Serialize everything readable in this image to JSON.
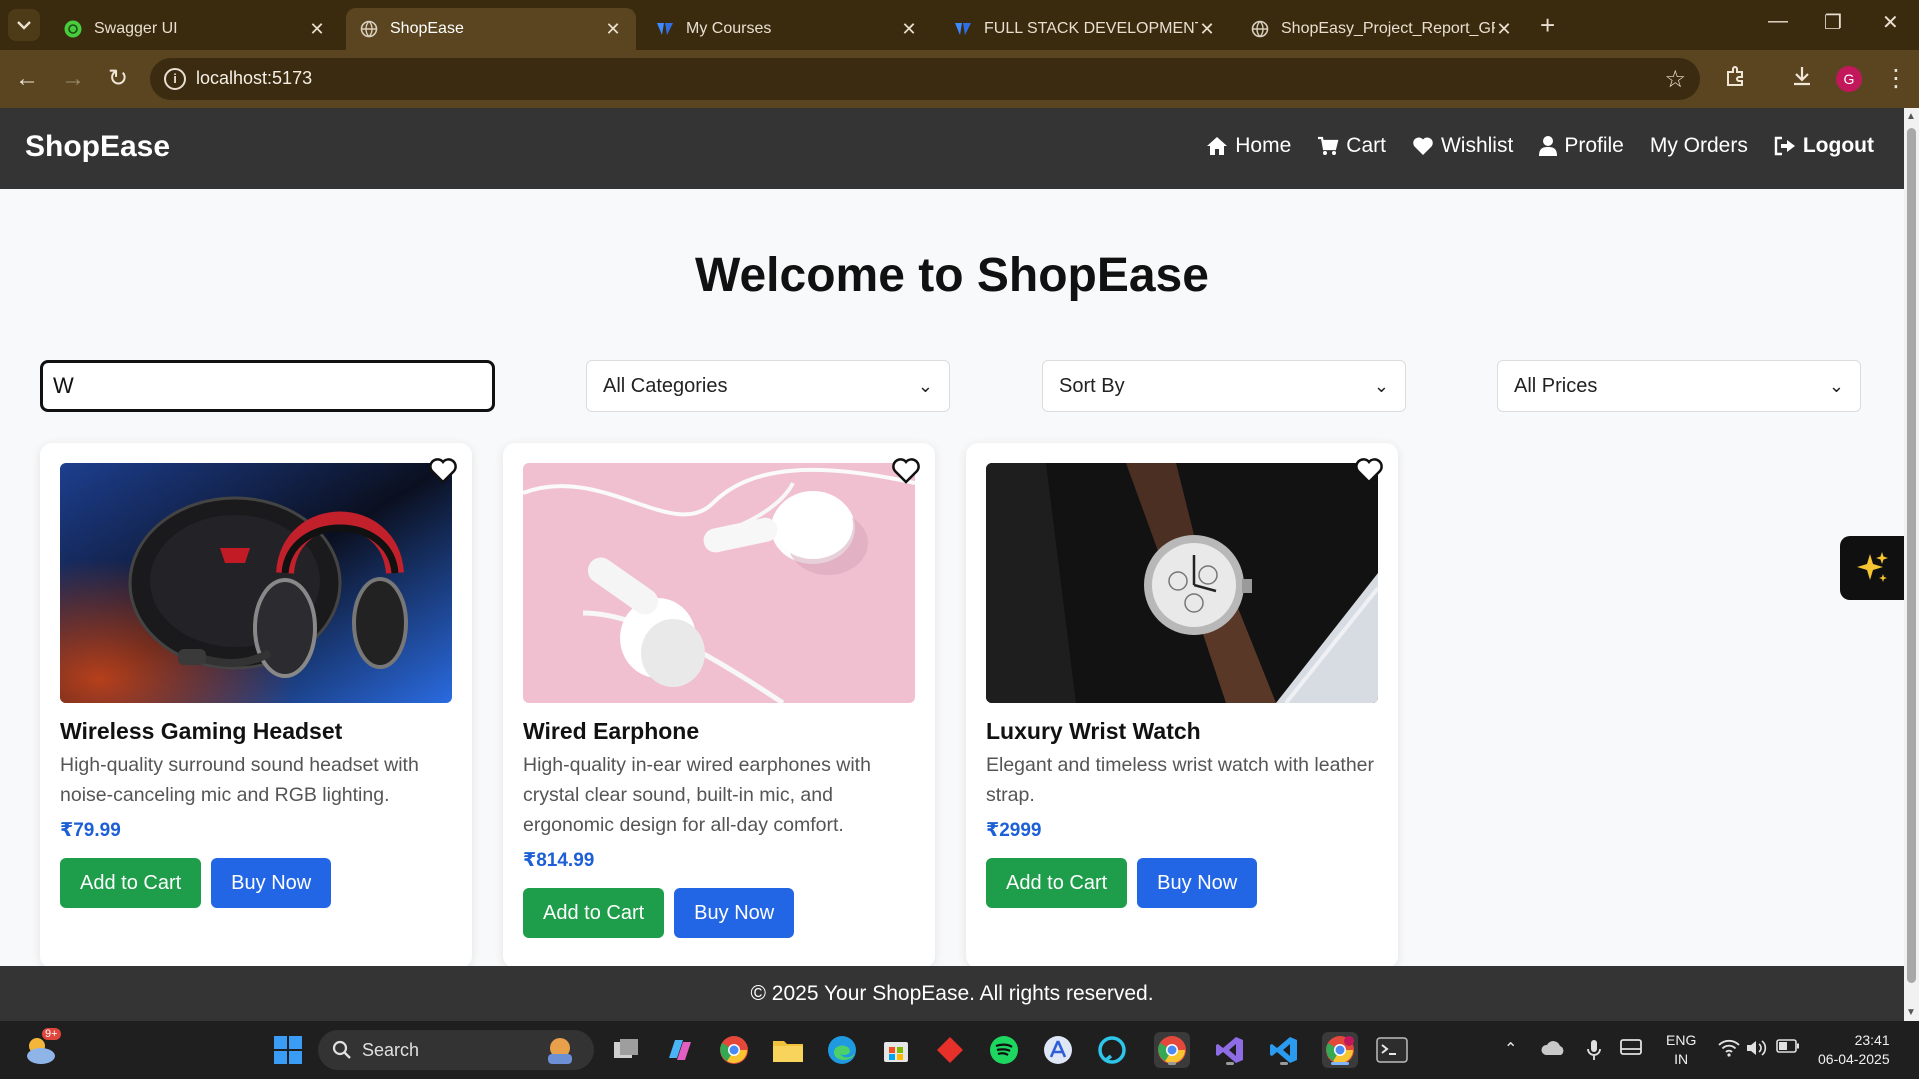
{
  "browser": {
    "tabs": [
      {
        "title": "Swagger UI",
        "active": false
      },
      {
        "title": "ShopEase",
        "active": true
      },
      {
        "title": "My Courses",
        "active": false
      },
      {
        "title": "FULL STACK DEVELOPMENT - C",
        "active": false
      },
      {
        "title": "ShopEasy_Project_Report_GRAC",
        "active": false
      }
    ],
    "url": "localhost:5173",
    "profile_initial": "G"
  },
  "site": {
    "brand": "ShopEase",
    "nav": {
      "home": "Home",
      "cart": "Cart",
      "wishlist": "Wishlist",
      "profile": "Profile",
      "orders": "My Orders",
      "logout": "Logout"
    },
    "hero_title": "Welcome to ShopEase",
    "filters": {
      "search_value": "W",
      "category": "All Categories",
      "sort": "Sort By",
      "price": "All Prices"
    },
    "products": [
      {
        "name": "Wireless Gaming Headset",
        "description": "High-quality surround sound headset with noise-canceling mic and RGB lighting.",
        "price": "₹79.99",
        "add_label": "Add to Cart",
        "buy_label": "Buy Now"
      },
      {
        "name": "Wired Earphone",
        "description": "High-quality in-ear wired earphones with crystal clear sound, built-in mic, and ergonomic design for all-day comfort.",
        "price": "₹814.99",
        "add_label": "Add to Cart",
        "buy_label": "Buy Now"
      },
      {
        "name": "Luxury Wrist Watch",
        "description": "Elegant and timeless wrist watch with leather strap.",
        "price": "₹2999",
        "add_label": "Add to Cart",
        "buy_label": "Buy Now"
      }
    ],
    "footer": "© 2025 Your ShopEase. All rights reserved."
  },
  "taskbar": {
    "search_label": "Search",
    "badge": "9+",
    "lang_line1": "ENG",
    "lang_line2": "IN",
    "time": "23:41",
    "date": "06-04-2025"
  },
  "colors": {
    "nav_bg": "#343434",
    "green": "#1e9e4a",
    "blue": "#2266e6",
    "price": "#1d5fd6"
  }
}
